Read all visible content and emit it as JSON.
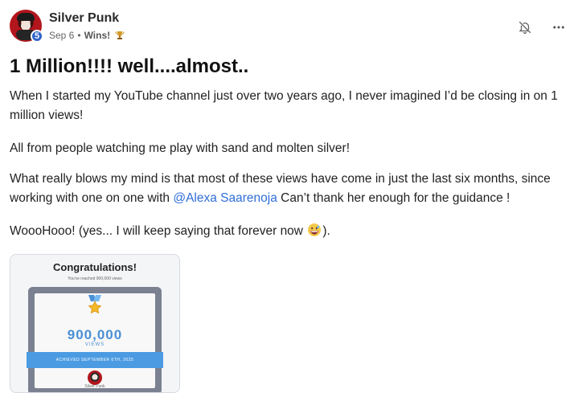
{
  "post": {
    "author": "Silver Punk",
    "level": "5",
    "date": "Sep 6",
    "separator": "•",
    "category": "Wins!",
    "title": "1 Million!!!! well....almost..",
    "paragraph1": "When I started my YouTube channel just over two years ago, I never imagined I’d be closing in on 1 million views!",
    "paragraph2": "All from people watching me play with sand and molten silver!",
    "paragraph3_before": "What really blows my mind is that most of these views have come in just the last six months, since working with one on one with ",
    "mention": "@Alexa Saarenoja",
    "paragraph3_after": " Can’t thank her enough for the guidance !",
    "paragraph4_before": "WoooHooo! (yes... I will keep saying that forever now ",
    "paragraph4_after": ")."
  },
  "image_card": {
    "title": "Congratulations!",
    "subtitle": "You've reached 900,000 views",
    "count": "900,000",
    "count_label": "VIEWS",
    "banner": "ACHIEVED SEPTEMBER 6TH, 2025",
    "name": "Silver Punk"
  },
  "icons": {
    "notification": "bell-off-icon",
    "more": "more-horizontal-icon",
    "trophy": "trophy-icon",
    "emoji": "grinning-sweat-emoji-icon"
  },
  "colors": {
    "mention": "#2f6ed8",
    "level_badge": "#2f63c8",
    "banner": "#4b9be2"
  }
}
